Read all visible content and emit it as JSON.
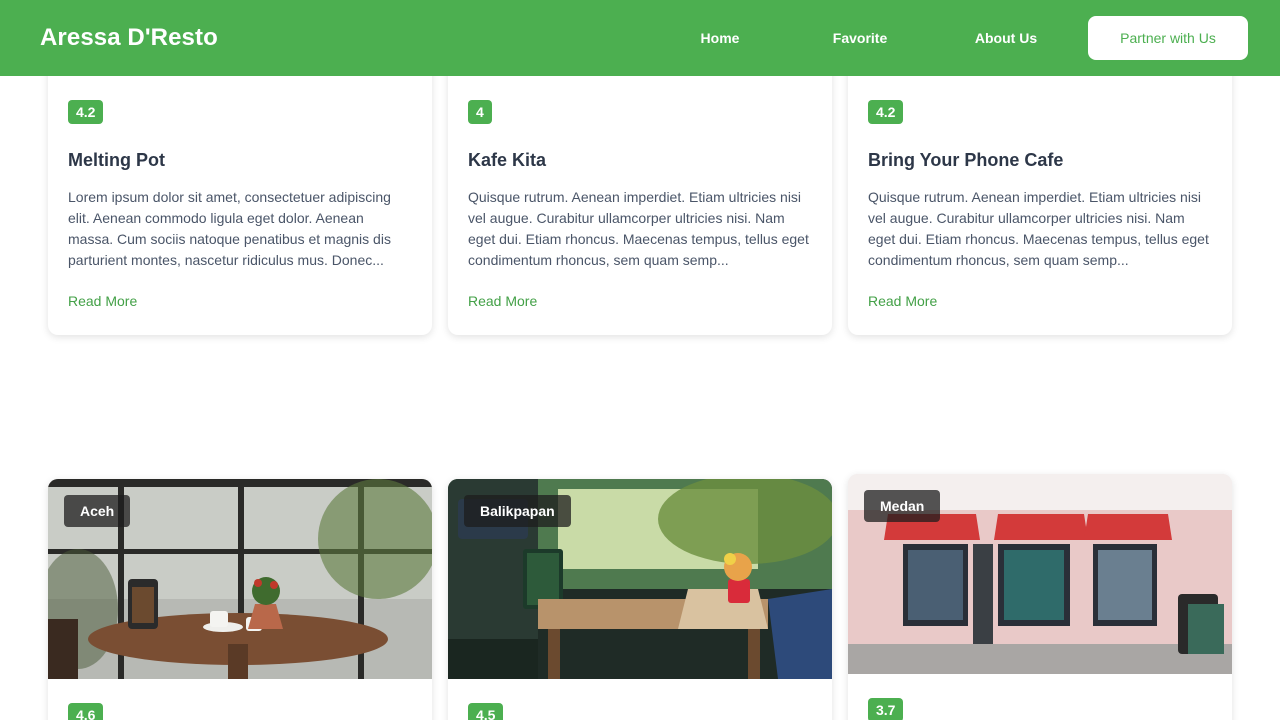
{
  "nav": {
    "brand": "Aressa D'Resto",
    "links": [
      "Home",
      "Favorite",
      "About Us"
    ],
    "cta": "Partner with Us"
  },
  "restaurants": [
    {
      "name": "Melting Pot",
      "rating": "4.2",
      "city": "",
      "description": "Lorem ipsum dolor sit amet, consectetuer adipiscing elit. Aenean commodo ligula eget dolor. Aenean massa. Cum sociis natoque penatibus et magnis dis parturient montes, nascetur ridiculus mus. Donec...",
      "read_more": "Read More"
    },
    {
      "name": "Kafe Kita",
      "rating": "4",
      "city": "",
      "description": "Quisque rutrum. Aenean imperdiet. Etiam ultricies nisi vel augue. Curabitur ullamcorper ultricies nisi. Nam eget dui. Etiam rhoncus. Maecenas tempus, tellus eget condimentum rhoncus, sem quam semp...",
      "read_more": "Read More"
    },
    {
      "name": "Bring Your Phone Cafe",
      "rating": "4.2",
      "city": "",
      "description": "Quisque rutrum. Aenean imperdiet. Etiam ultricies nisi vel augue. Curabitur ullamcorper ultricies nisi. Nam eget dui. Etiam rhoncus. Maecenas tempus, tellus eget condimentum rhoncus, sem quam semp...",
      "read_more": "Read More"
    },
    {
      "name": "",
      "rating": "4.6",
      "city": "Aceh",
      "description": "",
      "read_more": ""
    },
    {
      "name": "",
      "rating": "4.5",
      "city": "Balikpapan",
      "description": "",
      "read_more": ""
    },
    {
      "name": "",
      "rating": "3.7",
      "city": "Medan",
      "description": "",
      "read_more": ""
    }
  ],
  "colors": {
    "primary": "#4caf50",
    "link": "#43a047",
    "title": "#2d3748",
    "text": "#4a5568"
  }
}
